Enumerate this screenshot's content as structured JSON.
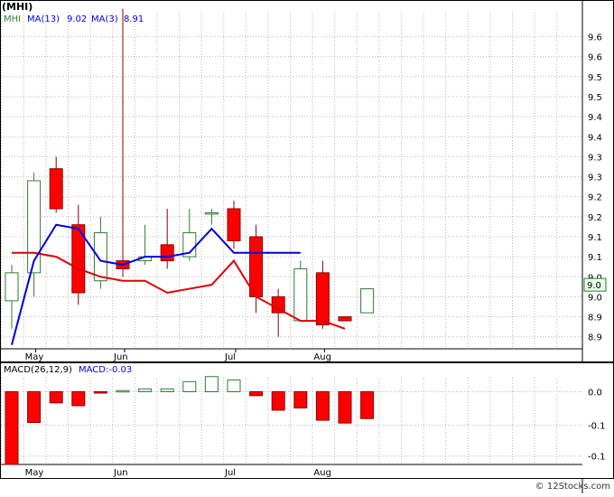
{
  "header": {
    "title": "(MHI)"
  },
  "watermark": "© 12Stocks.com",
  "colors": {
    "up_fill": "#ffffff",
    "up_stroke": "#2e7d32",
    "down_fill": "#ff0000",
    "down_stroke": "#8b0000",
    "ma13": "#e00000",
    "ma3": "#0000dd",
    "grid": "#bbbbbb",
    "frame": "#000000",
    "price_box_fill": "#e6ffe6"
  },
  "chart_data": [
    {
      "type": "candlestick",
      "title": "",
      "legend": {
        "symbol": "MHI",
        "ma13_label": "MA(13)",
        "ma13_value": "9.02",
        "ma3_label": "MA(3)",
        "ma3_value": "8.91"
      },
      "x_ticks": [
        "May",
        "Jun",
        "Jul",
        "Aug"
      ],
      "y_ticks": [
        "8.9",
        "8.9",
        "9.0",
        "9.0",
        "9.1",
        "9.1",
        "9.2",
        "9.2",
        "9.3",
        "9.3",
        "9.4",
        "9.4",
        "9.5",
        "9.5",
        "9.6",
        "9.6"
      ],
      "y_tick_values": [
        8.86,
        8.91,
        8.96,
        9.01,
        9.06,
        9.11,
        9.16,
        9.21,
        9.26,
        9.31,
        9.36,
        9.41,
        9.46,
        9.51,
        9.56,
        9.61
      ],
      "ylim": [
        8.83,
        9.67
      ],
      "current_price_label": "9.0",
      "current_price": 8.99,
      "grid": true,
      "weeks": [
        {
          "open": 8.95,
          "high": 9.04,
          "low": 8.88,
          "close": 9.02
        },
        {
          "open": 9.02,
          "high": 9.27,
          "low": 8.96,
          "close": 9.25
        },
        {
          "open": 9.28,
          "high": 9.31,
          "low": 9.17,
          "close": 9.18
        },
        {
          "open": 9.14,
          "high": 9.19,
          "low": 8.94,
          "close": 8.97
        },
        {
          "open": 9.0,
          "high": 9.16,
          "low": 8.98,
          "close": 9.12
        },
        {
          "open": 9.05,
          "high": 9.68,
          "low": 9.01,
          "close": 9.03
        },
        {
          "open": 9.05,
          "high": 9.14,
          "low": 9.04,
          "close": 9.06
        },
        {
          "open": 9.09,
          "high": 9.18,
          "low": 9.03,
          "close": 9.05
        },
        {
          "open": 9.06,
          "high": 9.18,
          "low": 9.05,
          "close": 9.12
        },
        {
          "open": 9.17,
          "high": 9.18,
          "low": 9.14,
          "close": 9.17
        },
        {
          "open": 9.18,
          "high": 9.2,
          "low": 9.08,
          "close": 9.1
        },
        {
          "open": 9.11,
          "high": 9.14,
          "low": 8.92,
          "close": 8.96
        },
        {
          "open": 8.96,
          "high": 8.98,
          "low": 8.86,
          "close": 8.92
        },
        {
          "open": 8.9,
          "high": 9.05,
          "low": 8.9,
          "close": 9.03
        },
        {
          "open": 9.02,
          "high": 9.05,
          "low": 8.88,
          "close": 8.89
        },
        {
          "open": 8.91,
          "high": 8.91,
          "low": 8.9,
          "close": 8.9
        },
        {
          "open": 8.92,
          "high": 8.98,
          "low": 8.92,
          "close": 8.98
        }
      ],
      "ma13": [
        9.07,
        9.07,
        9.06,
        9.03,
        9.01,
        9.0,
        9.0,
        8.97,
        8.98,
        8.99,
        9.05,
        8.96,
        8.93,
        8.9,
        8.9,
        8.88
      ],
      "ma3": [
        8.84,
        9.05,
        9.14,
        9.13,
        9.05,
        9.04,
        9.06,
        9.06,
        9.07,
        9.13,
        9.07,
        9.07,
        9.07,
        9.07
      ],
      "ma3_start": 0,
      "ma13_start": 0
    },
    {
      "type": "bar",
      "title": "",
      "legend": {
        "label": "MACD(26,12,9)",
        "value_label": "MACD:-0.03"
      },
      "y_ticks": [
        "0.0",
        "-0.1",
        "-0.1"
      ],
      "y_tick_values": [
        0.0,
        -0.06,
        -0.115
      ],
      "ylim": [
        -0.13,
        0.025
      ],
      "x_ticks": [
        "May",
        "Jun",
        "Jul",
        "Aug"
      ],
      "values": [
        -0.13,
        -0.055,
        -0.02,
        -0.025,
        -0.002,
        0.002,
        0.005,
        0.005,
        0.018,
        0.027,
        0.021,
        -0.007,
        -0.033,
        -0.029,
        -0.051,
        -0.056,
        -0.048
      ]
    }
  ]
}
